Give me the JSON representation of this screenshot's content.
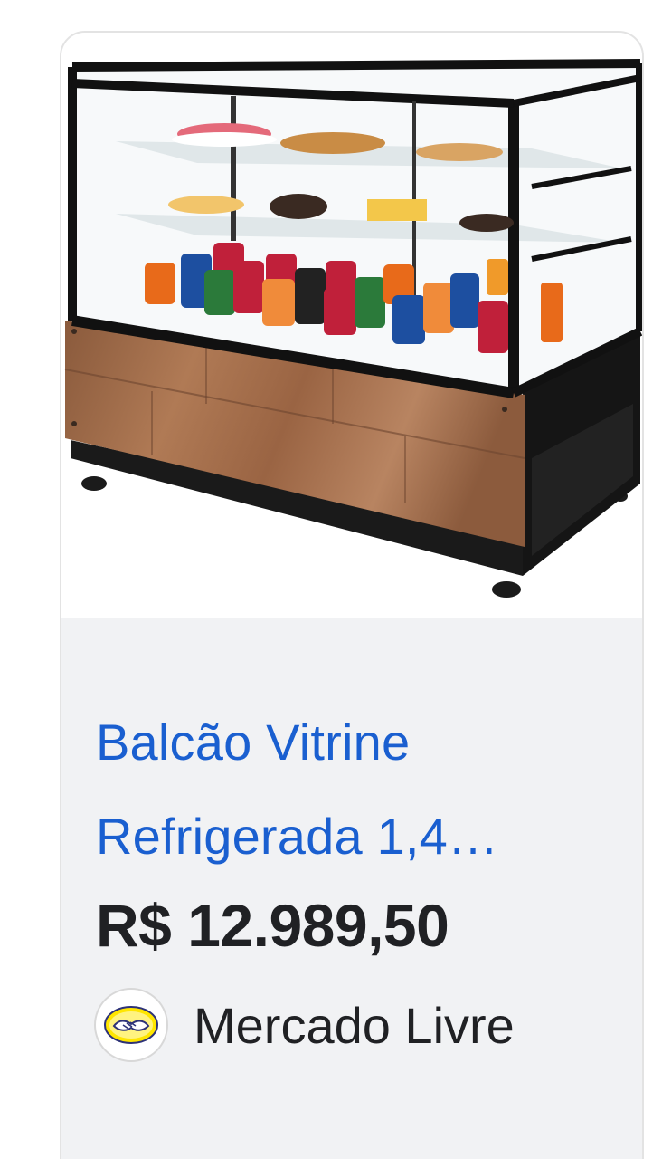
{
  "product": {
    "title_line1": "Balcão Vitrine",
    "title_line2": "Refrigerada 1,4…",
    "price": "R$ 12.989,50",
    "seller_name": "Mercado Livre",
    "seller_icon": "mercado-livre-handshake-icon",
    "image_icon": "refrigerated-display-counter-image"
  },
  "colors": {
    "title_link": "#1a5fd0",
    "price_text": "#202124",
    "card_bg": "#f1f2f4",
    "card_border": "#e3e3e3",
    "seller_logo_yellow": "#ffe600"
  }
}
